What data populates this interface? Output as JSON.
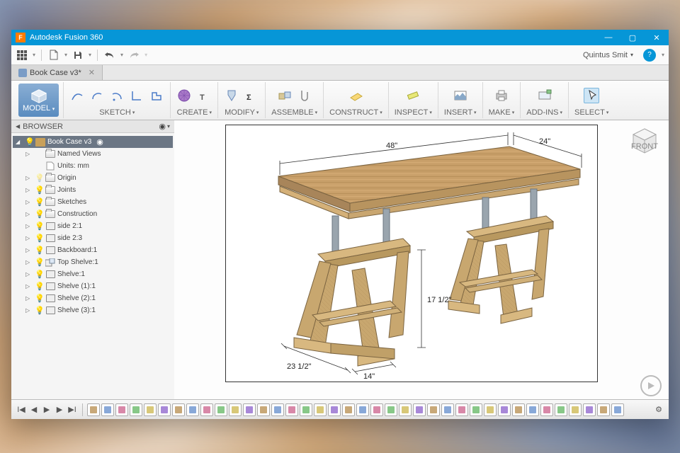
{
  "app": {
    "title": "Autodesk Fusion 360",
    "icon_letter": "F"
  },
  "window_controls": {
    "min": "—",
    "max": "▢",
    "close": "✕"
  },
  "qat": {
    "user_name": "Quintus Smit",
    "help": "?"
  },
  "tabs": {
    "active": "Book Case v3*"
  },
  "ribbon": {
    "model": "MODEL",
    "groups": [
      {
        "label": "SKETCH",
        "icons": [
          "spline",
          "arc",
          "arc2",
          "line",
          "profile"
        ]
      },
      {
        "label": "CREATE",
        "icons": [
          "mesh",
          "text"
        ]
      },
      {
        "label": "MODIFY",
        "icons": [
          "modify",
          "sigma"
        ]
      },
      {
        "label": "ASSEMBLE",
        "icons": [
          "joint",
          "clip"
        ]
      },
      {
        "label": "CONSTRUCT",
        "icons": [
          "plane"
        ]
      },
      {
        "label": "INSPECT",
        "icons": [
          "measure"
        ]
      },
      {
        "label": "INSERT",
        "icons": [
          "image"
        ]
      },
      {
        "label": "MAKE",
        "icons": [
          "print"
        ]
      },
      {
        "label": "ADD-INS",
        "icons": [
          "addin"
        ]
      },
      {
        "label": "SELECT",
        "icons": [
          "cursor"
        ]
      }
    ]
  },
  "browser": {
    "title": "BROWSER",
    "root": "Book Case v3",
    "items": [
      {
        "label": "Named Views",
        "type": "folder",
        "bulb": false
      },
      {
        "label": "Units: mm",
        "type": "doc",
        "bulb": false,
        "noarrow": true
      },
      {
        "label": "Origin",
        "type": "folder",
        "bulb": true,
        "dim": true
      },
      {
        "label": "Joints",
        "type": "folder",
        "bulb": true
      },
      {
        "label": "Sketches",
        "type": "folder",
        "bulb": true
      },
      {
        "label": "Construction",
        "type": "folder",
        "bulb": true
      },
      {
        "label": "side 2:1",
        "type": "comp",
        "bulb": true
      },
      {
        "label": "side 2:3",
        "type": "comp",
        "bulb": true
      },
      {
        "label": "Backboard:1",
        "type": "comp",
        "bulb": true
      },
      {
        "label": "Top Shelve:1",
        "type": "comp2",
        "bulb": true
      },
      {
        "label": "Shelve:1",
        "type": "comp",
        "bulb": true
      },
      {
        "label": "Shelve (1):1",
        "type": "comp",
        "bulb": true
      },
      {
        "label": "Shelve (2):1",
        "type": "comp",
        "bulb": true
      },
      {
        "label": "Shelve (3):1",
        "type": "comp",
        "bulb": true
      }
    ]
  },
  "canvas": {
    "dimensions": {
      "width": "48\"",
      "depth": "24\"",
      "leg_h": "17 1/2\"",
      "base_d": "23 1/2\"",
      "base_w": "14\""
    },
    "viewcube_face": "FRONT"
  },
  "timeline": {
    "item_count": 38
  }
}
